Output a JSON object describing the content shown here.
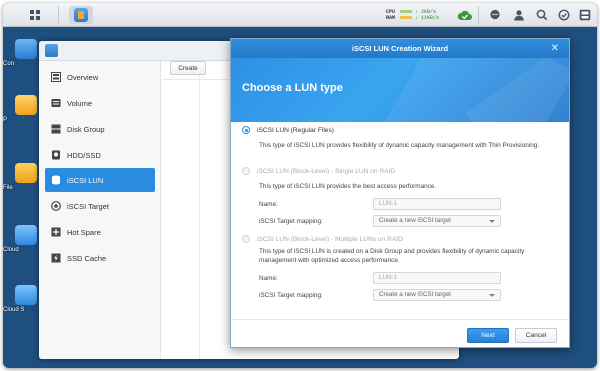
{
  "taskbar": {
    "cpu_label": "CPU",
    "ram_label": "RAM",
    "upload_rate": "↑ 2KB/s",
    "download_rate": "↓ 11KB/s",
    "tray_icons": [
      "sync-check-icon",
      "chat-icon",
      "user-icon",
      "search-icon",
      "options-icon",
      "widgets-icon"
    ]
  },
  "desktop": {
    "icons": [
      {
        "label": "Con",
        "icon": "control-panel-icon"
      },
      {
        "label": "P",
        "icon": "package-icon"
      },
      {
        "label": "File",
        "icon": "file-station-icon"
      },
      {
        "label": "Cloud",
        "icon": "cloud-icon"
      },
      {
        "label": "Cloud S",
        "icon": "cloud-sync-icon"
      }
    ]
  },
  "storage_manager": {
    "toolbar": {
      "create_label": "Create"
    },
    "sidebar": [
      {
        "label": "Overview",
        "icon": "overview-icon",
        "active": false
      },
      {
        "label": "Volume",
        "icon": "volume-icon",
        "active": false
      },
      {
        "label": "Disk Group",
        "icon": "disk-group-icon",
        "active": false
      },
      {
        "label": "HDD/SSD",
        "icon": "hdd-icon",
        "active": false
      },
      {
        "label": "iSCSI LUN",
        "icon": "iscsi-lun-icon",
        "active": true
      },
      {
        "label": "iSCSI Target",
        "icon": "iscsi-target-icon",
        "active": false
      },
      {
        "label": "Hot Spare",
        "icon": "hot-spare-icon",
        "active": false
      },
      {
        "label": "SSD Cache",
        "icon": "ssd-cache-icon",
        "active": false
      }
    ]
  },
  "wizard": {
    "title": "iSCSI LUN Creation Wizard",
    "heading": "Choose a LUN type",
    "options": [
      {
        "label": "iSCSI LUN (Regular Files)",
        "selected": true,
        "enabled": true,
        "description": "This type of iSCSI LUN provides flexibility of dynamic capacity management with Thin Provisioning."
      },
      {
        "label": "iSCSI LUN (Block-Level) - Single LUN on RAID",
        "selected": false,
        "enabled": false,
        "description": "This type of iSCSI LUN provides the best access performance.",
        "name_label": "Name:",
        "name_value": "LUN-1",
        "mapping_label": "iSCSI Target mapping:",
        "mapping_value": "Create a new iSCSI target"
      },
      {
        "label": "iSCSI LUN (Block-Level) - Multiple LUNs on RAID",
        "selected": false,
        "enabled": false,
        "description": "This type of iSCSI LUN is created on a Disk Group and provides flexibility of dynamic capacity management with optimized access performance.",
        "name_label": "Name:",
        "name_value": "LUN-1",
        "mapping_label": "iSCSI Target mapping:",
        "mapping_value": "Create a new iSCSI target"
      }
    ],
    "buttons": {
      "next": "Next",
      "cancel": "Cancel"
    }
  }
}
